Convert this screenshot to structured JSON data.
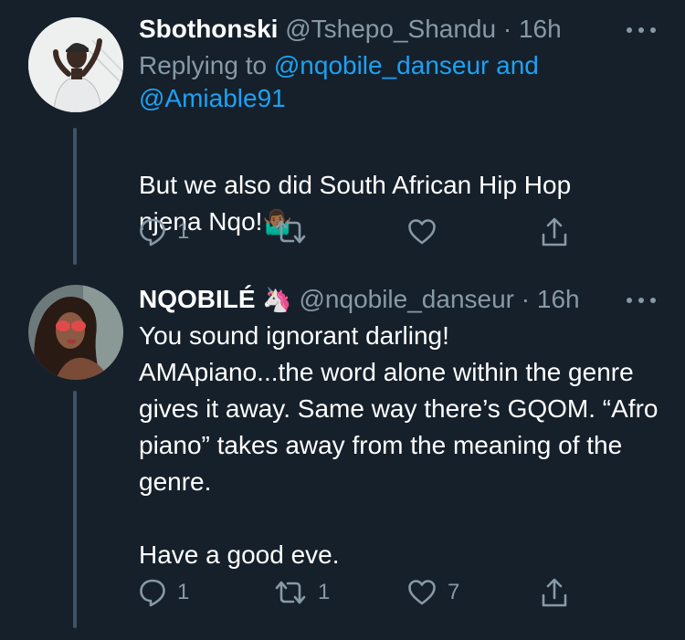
{
  "tweets": [
    {
      "display_name": "Sbothonski",
      "handle": "@Tshepo_Shandu",
      "separator": "·",
      "time": "16h",
      "replying_prefix": "Replying to ",
      "replying_user_1": "@nqobile_danseur",
      "replying_conj": " and",
      "replying_user_2": "@Amiable91",
      "text": "But we also did South African Hip Hop njena Nqo!",
      "emoji": "🤷🏾‍♂️",
      "reply_count": "1",
      "retweet_count": "",
      "like_count": ""
    },
    {
      "display_name": "NQOBILÉ",
      "name_emoji": "🦄",
      "handle": "@nqobile_danseur",
      "separator": "·",
      "time": "16h",
      "text": "You sound ignorant darling!\nAMApiano...the word alone within the genre gives it away. Same way there’s GQOM. “Afro piano” takes away from the meaning of the genre.\n\nHave a good eve.",
      "reply_count": "1",
      "retweet_count": "1",
      "like_count": "7"
    }
  ],
  "colors": {
    "background": "#15202b",
    "text": "#ffffff",
    "muted": "#8899a6",
    "link": "#1da1f2",
    "thread_line": "#3d5466"
  },
  "icons": {
    "more": "more-horizontal-icon",
    "reply": "reply-icon",
    "retweet": "retweet-icon",
    "like": "heart-icon",
    "share": "share-icon"
  }
}
